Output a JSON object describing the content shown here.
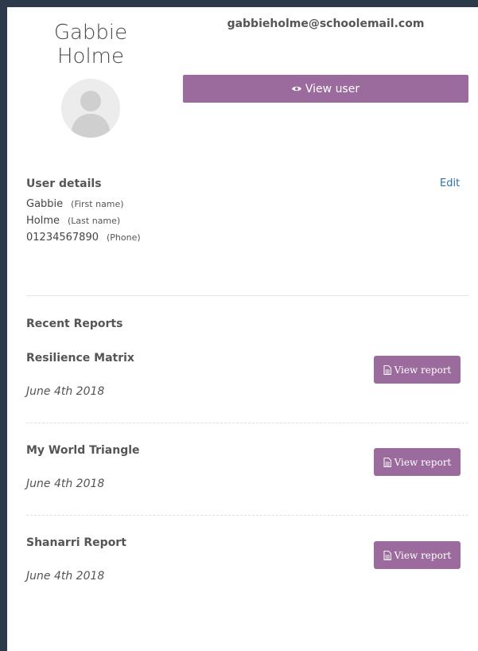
{
  "profile": {
    "first_name_display": "Gabbie",
    "last_name_display": "Holme",
    "email": "gabbieholme@schoolemail.com",
    "view_user_label": "View user",
    "view_user_icon": "eye-icon"
  },
  "details": {
    "title": "User details",
    "edit_label": "Edit",
    "rows": [
      {
        "value": "Gabbie",
        "hint": "(First name)"
      },
      {
        "value": "Holme",
        "hint": "(Last name)"
      },
      {
        "value": "01234567890",
        "hint": "(Phone)"
      }
    ]
  },
  "reports": {
    "title": "Recent Reports",
    "button_label": "View report",
    "button_icon": "document-icon",
    "items": [
      {
        "name": "Resilience Matrix",
        "date": "June 4th 2018"
      },
      {
        "name": "My World Triangle",
        "date": "June 4th 2018"
      },
      {
        "name": "Shanarri Report",
        "date": "June 4th 2018"
      }
    ]
  },
  "colors": {
    "accent": "#9c6b9e",
    "link": "#2d6ea8",
    "background": "#2c3a4b"
  }
}
